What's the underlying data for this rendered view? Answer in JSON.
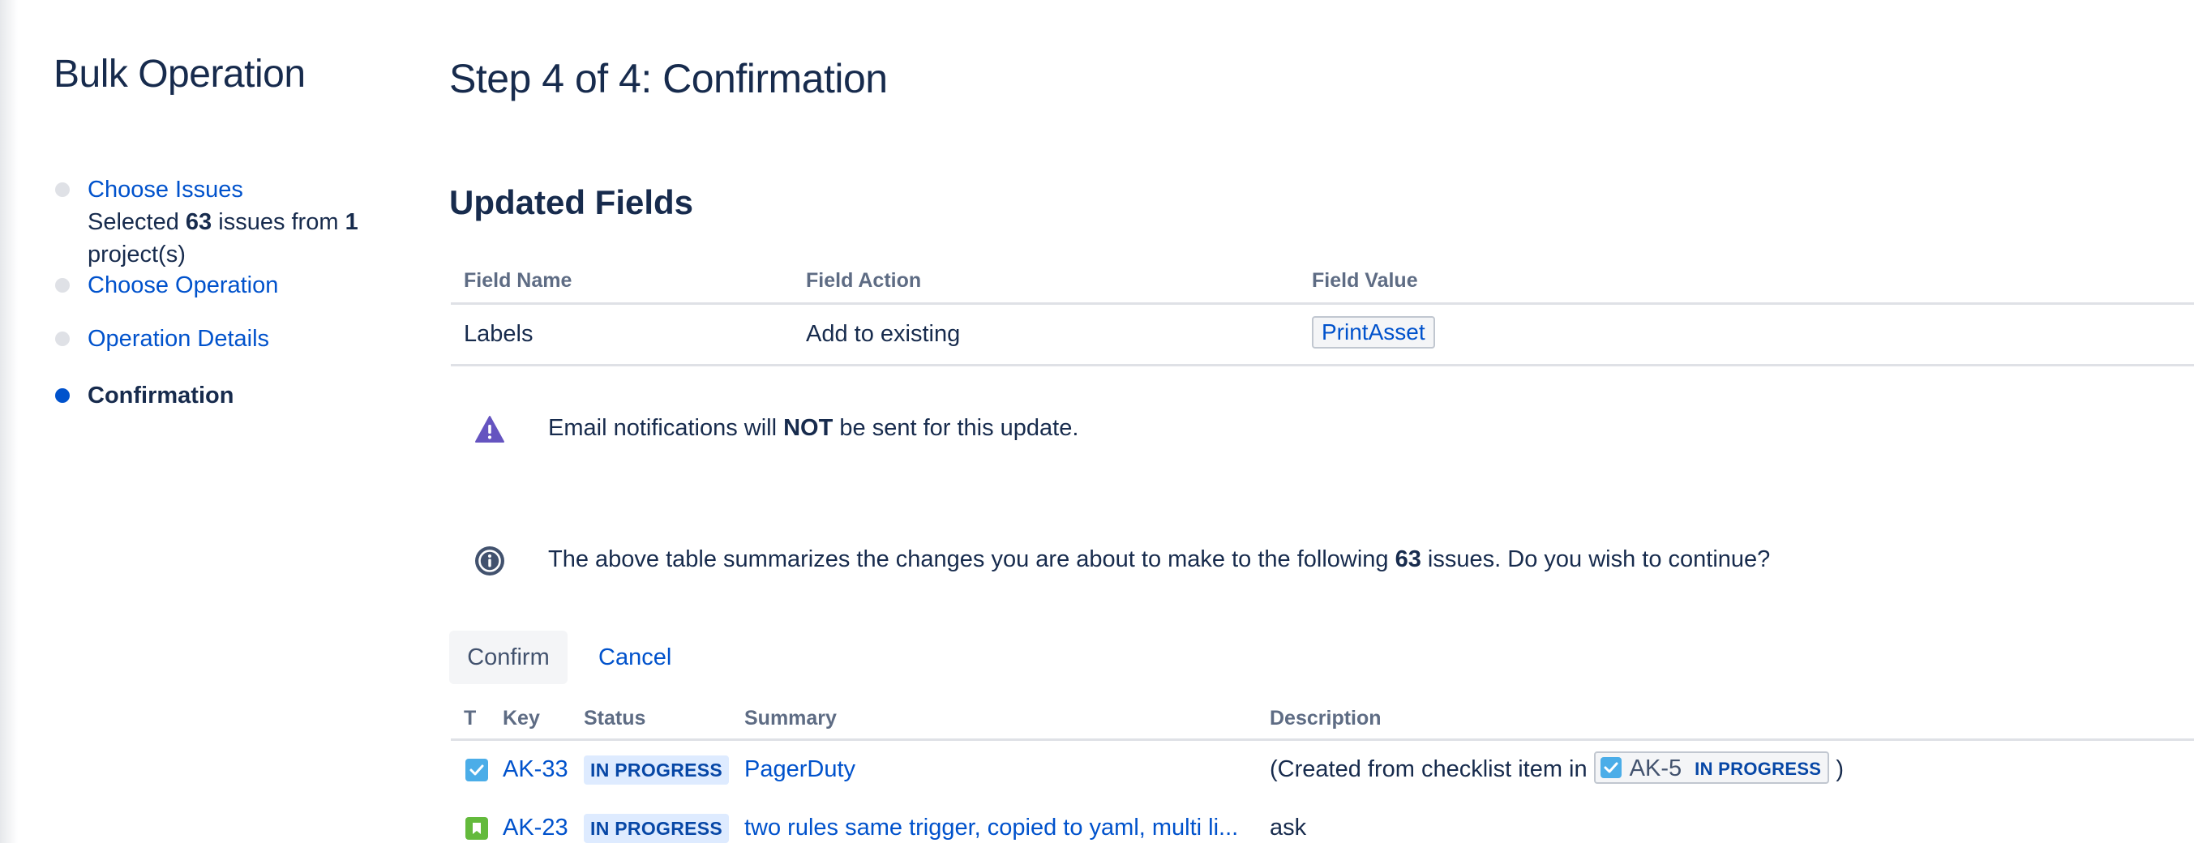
{
  "sidebar": {
    "title": "Bulk Operation",
    "steps": [
      {
        "label": "Choose Issues",
        "detail_prefix": "Selected ",
        "detail_count": "63",
        "detail_mid": " issues from ",
        "detail_projects": "1",
        "detail_suffix": "project(s)"
      },
      {
        "label": "Choose Operation"
      },
      {
        "label": "Operation Details"
      },
      {
        "label": "Confirmation"
      }
    ]
  },
  "main": {
    "title": "Step 4 of 4: Confirmation",
    "section_title": "Updated Fields",
    "fields_table": {
      "headers": [
        "Field Name",
        "Field Action",
        "Field Value"
      ],
      "rows": [
        {
          "name": "Labels",
          "action": "Add to existing",
          "value": "PrintAsset"
        }
      ]
    },
    "warning": {
      "prefix": "Email notifications will ",
      "bold": "NOT",
      "suffix": " be sent for this update."
    },
    "info": {
      "prefix": "The above table summarizes the changes you are about to make to the following ",
      "count": "63",
      "suffix": " issues. Do you wish to continue?"
    },
    "buttons": {
      "confirm": "Confirm",
      "cancel": "Cancel"
    },
    "issues_table": {
      "headers": [
        "T",
        "Key",
        "Status",
        "Summary",
        "Description"
      ],
      "rows": [
        {
          "type": "task",
          "key": "AK-33",
          "status": "IN PROGRESS",
          "summary": "PagerDuty",
          "desc_prefix": "(Created from checklist item in ",
          "desc_issue_key": "AK-5",
          "desc_issue_status": "IN PROGRESS",
          "desc_suffix": ")"
        },
        {
          "type": "story",
          "key": "AK-23",
          "status": "IN PROGRESS",
          "summary": "two rules same trigger, copied to yaml, multi li...",
          "description": "ask"
        }
      ]
    }
  },
  "colors": {
    "link": "#0052cc",
    "text": "#172b4d",
    "lozenge_bg": "#deebff",
    "warning_icon": "#6554c0",
    "info_icon": "#42526e"
  }
}
